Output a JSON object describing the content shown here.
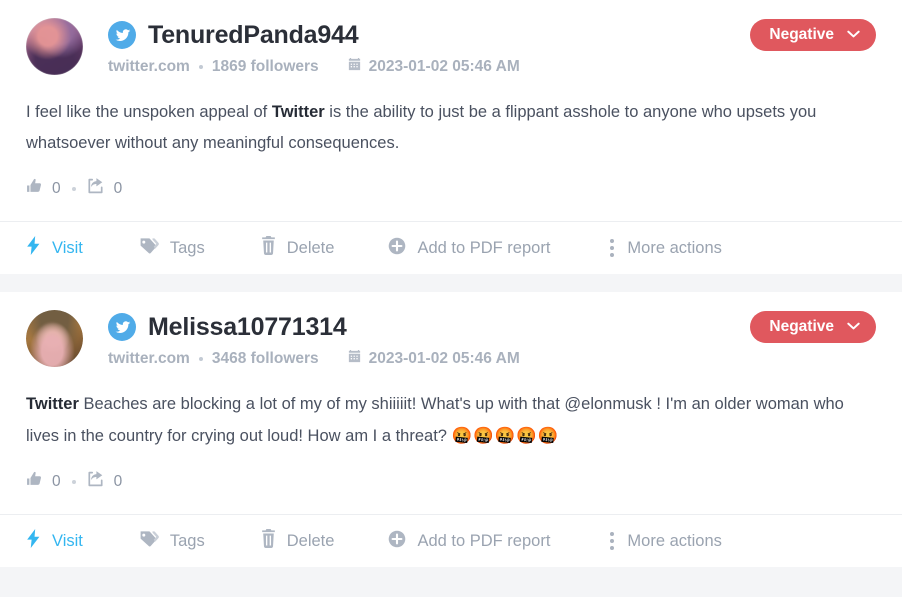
{
  "theme": {
    "page_background": "#f4f5f7",
    "card_background": "#ffffff",
    "accent_link": "#34b6f0",
    "sentiment_negative": "#e0585e",
    "twitter_blue": "#50abe8",
    "muted_text": "#a9b1bd",
    "body_text": "#4a5160"
  },
  "posts": [
    {
      "author": "TenuredPanda944",
      "network_icon": "twitter-icon",
      "source": "twitter.com",
      "followers": "1869 followers",
      "date": "2023-01-02 05:46 AM",
      "sentiment": {
        "label": "Negative",
        "color": "#e0585e",
        "caret_icon": "chevron-down-icon"
      },
      "content": {
        "parts": [
          {
            "text": "I feel like the unspoken appeal of ",
            "bold": false
          },
          {
            "text": "Twitter",
            "bold": true
          },
          {
            "text": " is the ability to just be a flippant asshole to anyone who upsets you whatsoever without any meaningful consequences.",
            "bold": false
          }
        ]
      },
      "engagement": {
        "likes_icon": "thumbs-up-icon",
        "likes": "0",
        "shares_icon": "share-icon",
        "shares": "0"
      },
      "actions": [
        {
          "label": "Visit",
          "icon": "lightning-bolt-icon",
          "highlight": true
        },
        {
          "label": "Tags",
          "icon": "tag-icon",
          "highlight": false
        },
        {
          "label": "Delete",
          "icon": "trash-icon",
          "highlight": false
        },
        {
          "label": "Add to PDF report",
          "icon": "plus-circle-icon",
          "highlight": false
        },
        {
          "label": "More actions",
          "icon": "vertical-dots-icon",
          "highlight": false
        }
      ]
    },
    {
      "author": "Melissa10771314",
      "network_icon": "twitter-icon",
      "source": "twitter.com",
      "followers": "3468 followers",
      "date": "2023-01-02 05:46 AM",
      "sentiment": {
        "label": "Negative",
        "color": "#e0585e",
        "caret_icon": "chevron-down-icon"
      },
      "content": {
        "parts": [
          {
            "text": "Twitter",
            "bold": true
          },
          {
            "text": " Beaches are blocking a lot of my of my shiiiiit! What's up with that @elonmusk ! I'm an older woman who lives in the country for crying out loud! How am I a threat? ",
            "bold": false
          },
          {
            "text": "🤬🤬🤬🤬🤬",
            "bold": false,
            "emoji": true
          }
        ]
      },
      "engagement": {
        "likes_icon": "thumbs-up-icon",
        "likes": "0",
        "shares_icon": "share-icon",
        "shares": "0"
      },
      "actions": [
        {
          "label": "Visit",
          "icon": "lightning-bolt-icon",
          "highlight": true
        },
        {
          "label": "Tags",
          "icon": "tag-icon",
          "highlight": false
        },
        {
          "label": "Delete",
          "icon": "trash-icon",
          "highlight": false
        },
        {
          "label": "Add to PDF report",
          "icon": "plus-circle-icon",
          "highlight": false
        },
        {
          "label": "More actions",
          "icon": "vertical-dots-icon",
          "highlight": false
        }
      ]
    }
  ]
}
